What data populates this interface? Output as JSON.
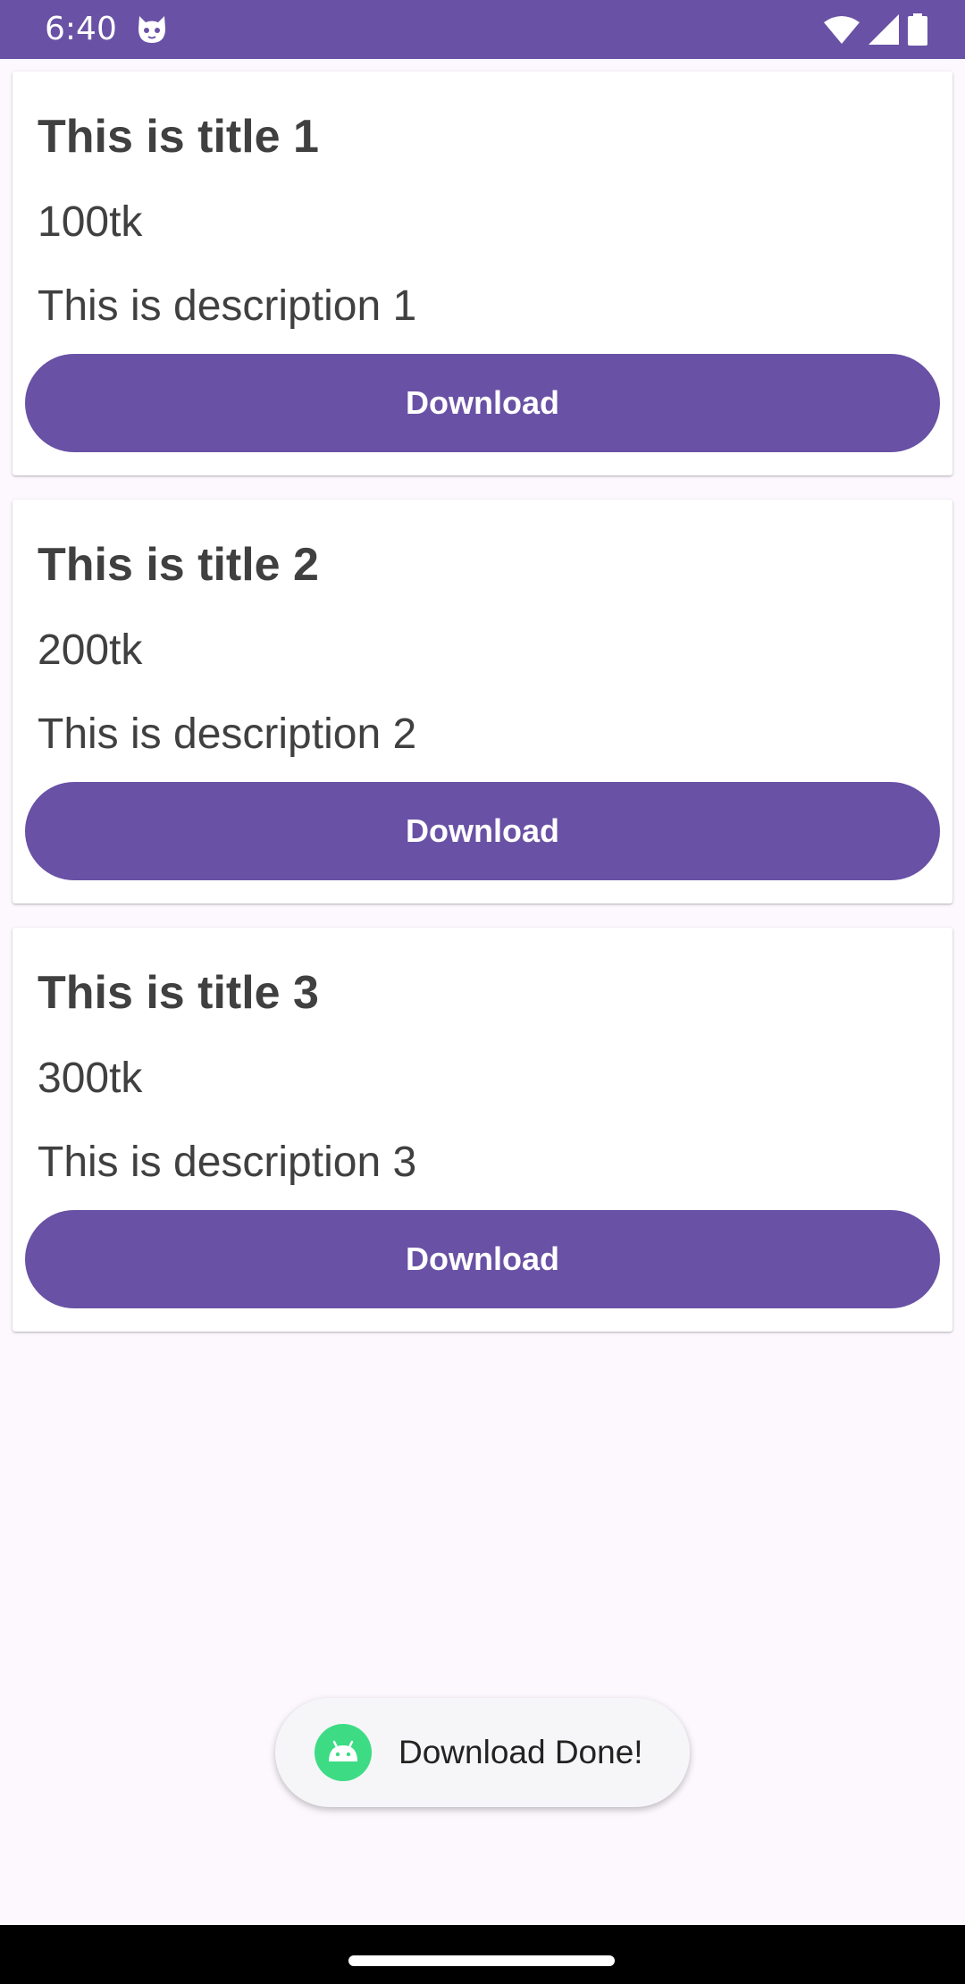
{
  "status_bar": {
    "time": "6:40",
    "icons": [
      "cat-notification-icon",
      "wifi-icon",
      "signal-icon",
      "battery-icon"
    ]
  },
  "colors": {
    "accent": "#6951a5",
    "background": "#fdf7fe",
    "text": "#404040"
  },
  "cards": [
    {
      "title": "This is title 1",
      "price": "100tk",
      "description": "This is description 1",
      "button_label": "Download"
    },
    {
      "title": "This is title 2",
      "price": "200tk",
      "description": "This is description 2",
      "button_label": "Download"
    },
    {
      "title": "This is title 3",
      "price": "300tk",
      "description": "This is description 3",
      "button_label": "Download"
    }
  ],
  "toast": {
    "icon": "android-icon",
    "message": "Download Done!"
  }
}
